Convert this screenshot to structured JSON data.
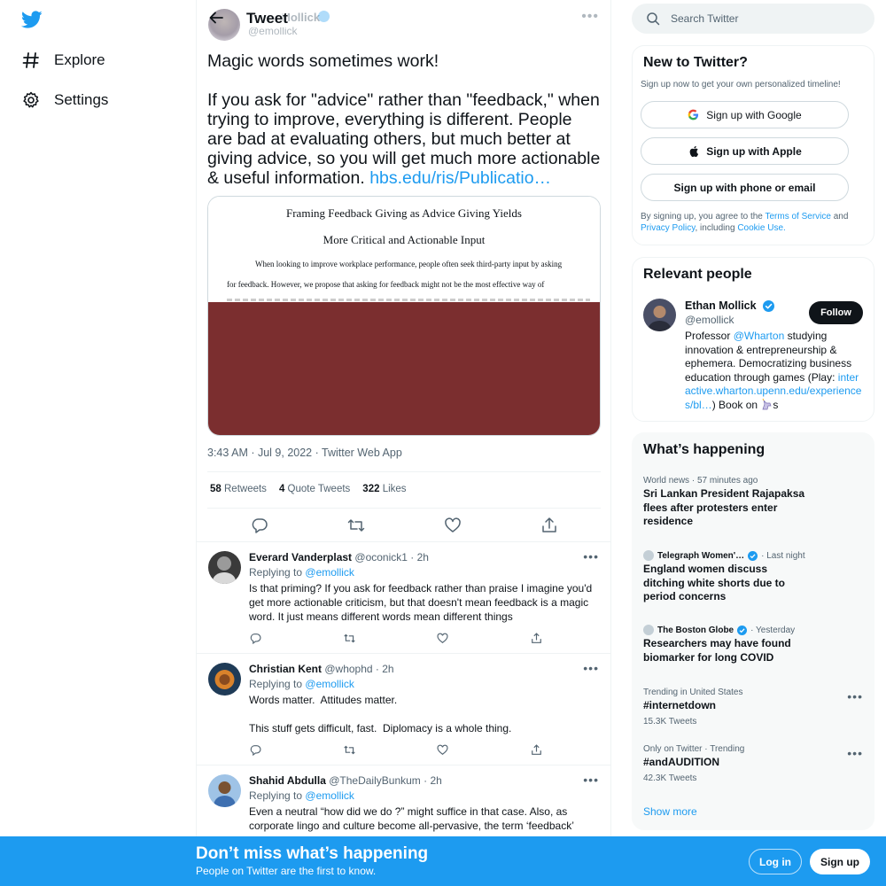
{
  "nav": {
    "logo_icon": "twitter-bird-icon",
    "items": [
      {
        "label": "Explore",
        "icon": "hashtag-icon"
      },
      {
        "label": "Settings",
        "icon": "gear-icon"
      }
    ]
  },
  "header": {
    "title": "Tweet",
    "ghost_name": "Mollick",
    "ghost_handle": "@emollick"
  },
  "tweet": {
    "line1": "Magic words sometimes work!",
    "body": "If you ask for \"advice\" rather than \"feedback,\" when trying to improve, everything is different. People are bad at evaluating others, but much better at giving advice, so you will get much more actionable & useful information.",
    "link": "hbs.edu/ris/Publicatio…",
    "card": {
      "title1": "Framing Feedback Giving as Advice Giving Yields",
      "title2": "More Critical and Actionable Input",
      "line1": "When looking to improve workplace performance, people often seek third-party input by asking",
      "line2": "for feedback. However, we propose that asking for feedback might not be the most effective way of"
    },
    "meta": "3:43 AM · Jul 9, 2022 · Twitter Web App",
    "stats": {
      "retweets_count": "58",
      "retweets_label": "Retweets",
      "quotes_count": "4",
      "quotes_label": "Quote Tweets",
      "likes_count": "322",
      "likes_label": "Likes"
    }
  },
  "replies": [
    {
      "name": "Everard Vanderplast",
      "handle": "@oconick1",
      "time": "· 2h",
      "replying_prefix": "Replying to",
      "replying_to": "@emollick",
      "text": "Is that priming? If you ask for feedback rather than praise I imagine you'd get more actionable criticism, but that doesn't mean feedback is a magic word. It just means different words mean different things"
    },
    {
      "name": "Christian Kent",
      "handle": "@whophd",
      "time": "· 2h",
      "replying_prefix": "Replying to",
      "replying_to": "@emollick",
      "text_p1": "Words matter.  Attitudes matter.",
      "text_p2": "This stuff gets difficult, fast.  Diplomacy is a whole thing."
    },
    {
      "name": "Shahid Abdulla",
      "handle": "@TheDailyBunkum",
      "time": "· 2h",
      "replying_prefix": "Replying to",
      "replying_to": "@emollick",
      "text": "Even a neutral “how did we do ?” might suffice in that case. Also, as corporate lingo and culture become all-pervasive, the term ‘feedback’"
    }
  ],
  "search": {
    "placeholder": "Search Twitter"
  },
  "new_to_twitter": {
    "title": "New to Twitter?",
    "subtitle": "Sign up now to get your own personalized timeline!",
    "google": "Sign up with Google",
    "apple": "Sign up with Apple",
    "phone": "Sign up with phone or email",
    "terms_prefix": "By signing up, you agree to the",
    "terms_link": "Terms of Service",
    "terms_and": "and",
    "privacy_link": "Privacy Policy",
    "including": ", including",
    "cookie_link": "Cookie Use."
  },
  "relevant_people": {
    "title": "Relevant people",
    "name": "Ethan Mollick",
    "handle": "@emollick",
    "follow": "Follow",
    "bio_1": "Professor",
    "bio_mention": "@Wharton",
    "bio_2": "studying innovation & entrepreneurship & ephemera. Democratizing business education through games (Play:",
    "bio_link": "interactive.wharton.upenn.edu/experiences/bl…",
    "bio_3": ") Book on",
    "bio_4": "s"
  },
  "whats_happening": {
    "title": "What’s happening",
    "trends": [
      {
        "context": "World news · 57 minutes ago",
        "title": "Sri Lankan President Rajapaksa flees after protesters enter residence"
      },
      {
        "source": "Telegraph Women'…",
        "time": "· Last night",
        "title": "England women discuss ditching white shorts due to period concerns"
      },
      {
        "source": "The Boston Globe",
        "time": "· Yesterday",
        "title": "Researchers may have found biomarker for long COVID"
      },
      {
        "context": "Trending in United States",
        "title": "#internetdown",
        "count": "15.3K Tweets"
      },
      {
        "context": "Only on Twitter · Trending",
        "title": "#andAUDITION",
        "count": "42.3K Tweets"
      }
    ],
    "show_more": "Show more"
  },
  "bottom_bar": {
    "title": "Don’t miss what’s happening",
    "subtitle": "People on Twitter are the first to know.",
    "login": "Log in",
    "signup": "Sign up"
  },
  "colors": {
    "accent": "#1d9bf0",
    "text": "#0f1419",
    "muted": "#536471",
    "card_maroon": "#7b2e2f"
  }
}
